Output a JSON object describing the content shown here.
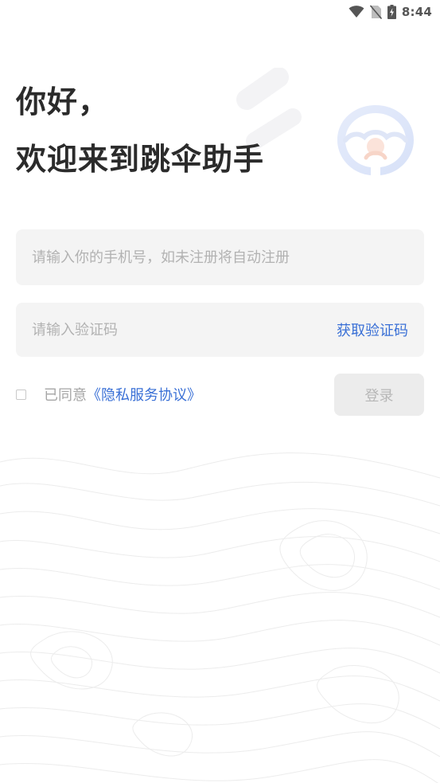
{
  "status_bar": {
    "time": "8:44",
    "icons": [
      "wifi-icon",
      "no-sim-icon",
      "battery-charging-icon"
    ]
  },
  "greeting": {
    "line1": "你好，",
    "line2": "欢迎来到跳伞助手"
  },
  "form": {
    "phone_placeholder": "请输入你的手机号，如未注册将自动注册",
    "code_placeholder": "请输入验证码",
    "get_code_label": "获取验证码"
  },
  "agreement": {
    "checked": false,
    "prefix": "已同意",
    "link_label": "《隐私服务协议》"
  },
  "login_button": {
    "label": "登录"
  },
  "colors": {
    "accent": "#3a70d6",
    "field_bg": "#f4f4f4",
    "button_disabled_bg": "#ececec",
    "title": "#2b2b2b",
    "placeholder": "#b2b2b2"
  }
}
